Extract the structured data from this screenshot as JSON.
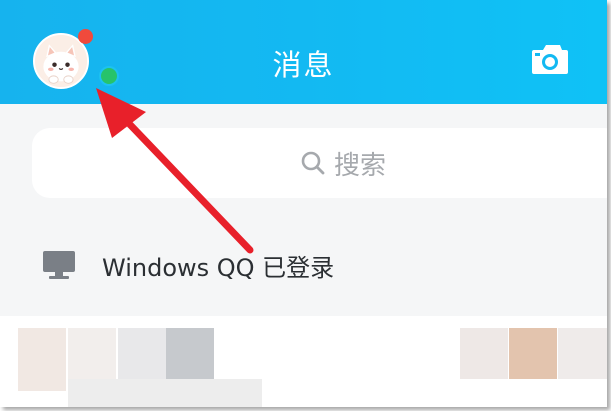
{
  "header": {
    "title": "消息",
    "avatar_icon": "cat-avatar-icon",
    "camera_icon": "camera-icon",
    "status_colors": {
      "notification": "#f04a3c",
      "online": "#27c36b"
    },
    "background": "#13b9f2"
  },
  "search": {
    "placeholder": "搜索",
    "icon": "search-icon"
  },
  "login_banner": {
    "icon": "monitor-icon",
    "text": "Windows QQ 已登录"
  },
  "annotation": {
    "type": "arrow",
    "color": "#e8202a"
  }
}
